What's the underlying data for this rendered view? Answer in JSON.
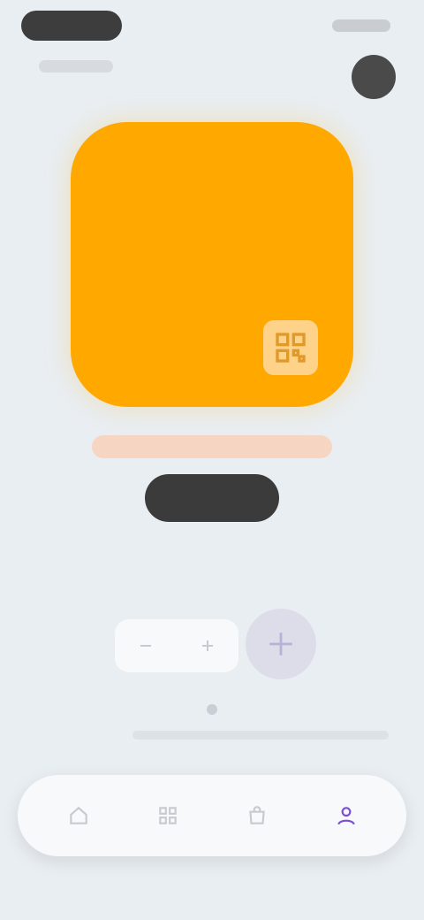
{
  "header": {
    "title": "",
    "status_time": ""
  },
  "card": {
    "color": "#ffa800"
  },
  "hint": {
    "text": ""
  },
  "primary_button": {
    "label": ""
  },
  "controls": {
    "label": ""
  },
  "icons": {
    "qr": "qr-code-icon",
    "minus": "minus-icon",
    "plus": "plus-icon",
    "action": "spark-icon",
    "nav": [
      "home-icon",
      "grid-icon",
      "bag-icon",
      "profile-icon"
    ]
  },
  "colors": {
    "background": "#e9eef2",
    "accent": "#7a4fd6",
    "dark": "#3b3b3b"
  }
}
